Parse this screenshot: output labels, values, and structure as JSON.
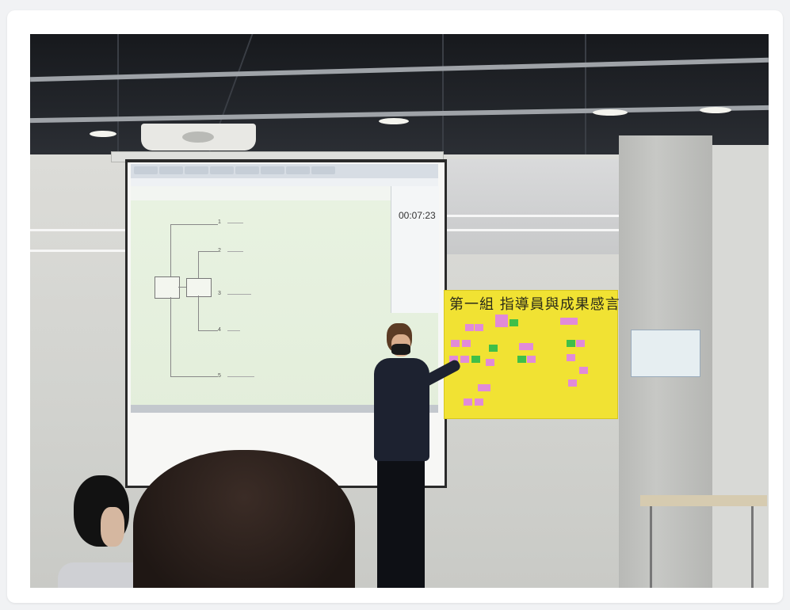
{
  "photo": {
    "slide": {
      "timer": "00:07:23",
      "nodes": [
        "1",
        "2",
        "3",
        "4",
        "5"
      ]
    },
    "poster": {
      "title": "第一組 指導員與成果感言"
    }
  }
}
